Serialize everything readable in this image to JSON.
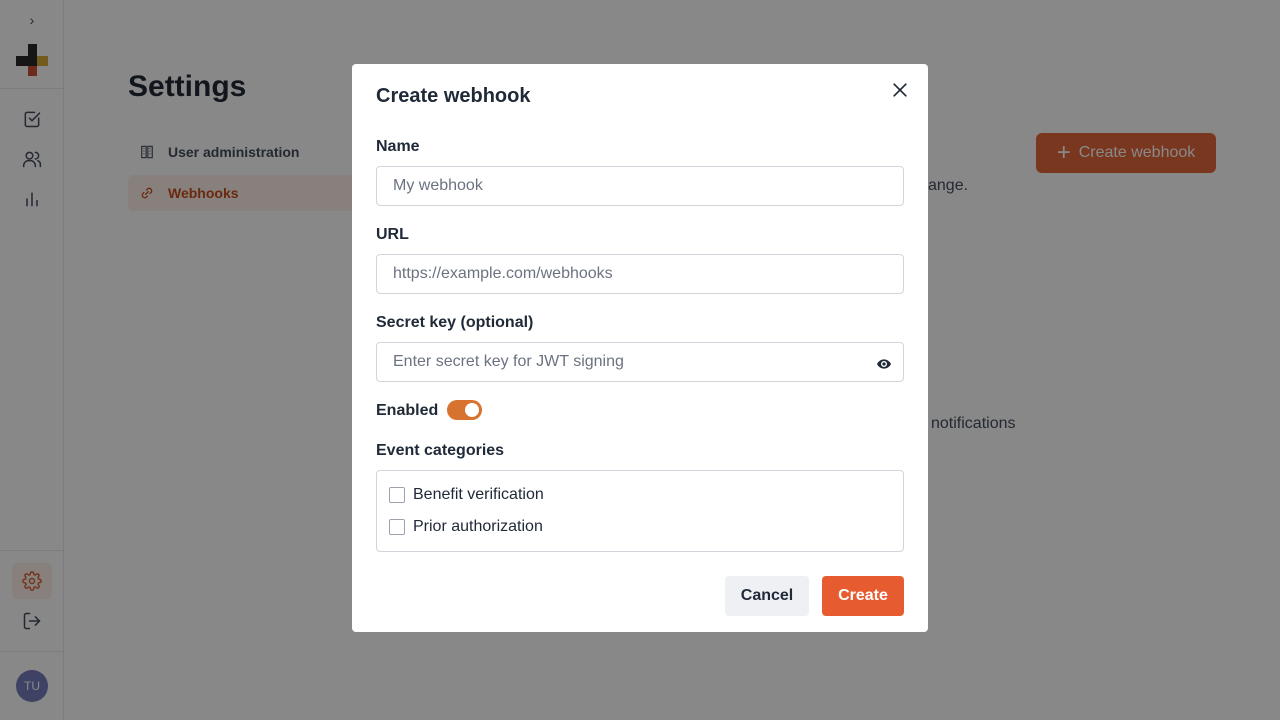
{
  "sidebar": {
    "expand_glyph": "›",
    "items": [
      {
        "icon": "task-checkbox-icon"
      },
      {
        "icon": "users-icon"
      },
      {
        "icon": "bar-chart-icon"
      }
    ],
    "bottom_items": [
      {
        "icon": "gear-icon",
        "active": true
      },
      {
        "icon": "logout-icon"
      }
    ],
    "avatar_initials": "TU",
    "avatar_color": "#6b72b8"
  },
  "page": {
    "title": "Settings",
    "nav": [
      {
        "label": "User administration",
        "icon": "building-icon"
      },
      {
        "label": "Webhooks",
        "icon": "link-icon",
        "active": true
      }
    ],
    "create_button_label": "Create webhook",
    "partial_text_1": "ange.",
    "partial_text_2": "notifications"
  },
  "modal": {
    "title": "Create webhook",
    "name_label": "Name",
    "name_placeholder": "My webhook",
    "url_label": "URL",
    "url_placeholder": "https://example.com/webhooks",
    "secret_label": "Secret key (optional)",
    "secret_placeholder": "Enter secret key for JWT signing",
    "enabled_label": "Enabled",
    "enabled": true,
    "categories_label": "Event categories",
    "categories": [
      {
        "label": "Benefit verification",
        "checked": false
      },
      {
        "label": "Prior authorization",
        "checked": false
      }
    ],
    "cancel_label": "Cancel",
    "create_label": "Create"
  },
  "colors": {
    "accent": "#e65c30",
    "toggle_on": "#d8722f",
    "overlay": "rgba(17,17,17,0.5)"
  }
}
